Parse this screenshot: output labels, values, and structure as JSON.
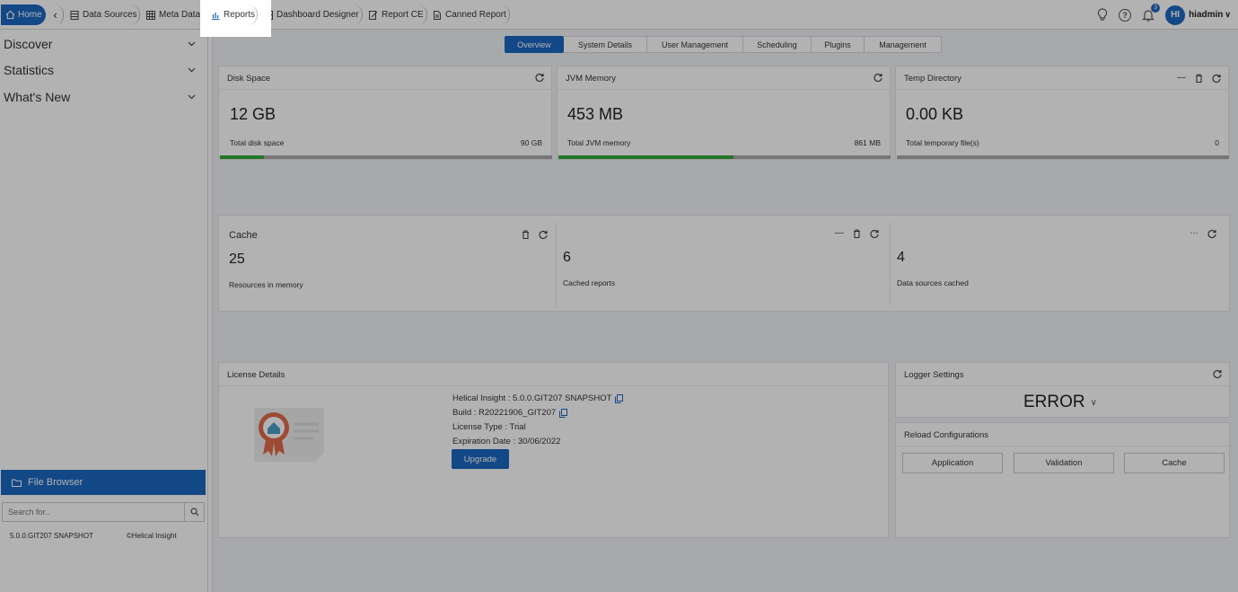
{
  "topbar": {
    "home_label": "Home",
    "tabs": [
      {
        "label": "Data Sources",
        "icon": "table-icon"
      },
      {
        "label": "Meta Data",
        "icon": "grid-icon"
      },
      {
        "label": "Reports",
        "icon": "bar-chart-icon"
      },
      {
        "label": "Dashboard Designer",
        "icon": "image-icon"
      },
      {
        "label": "Report CE",
        "icon": "edit-doc-icon"
      },
      {
        "label": "Canned Report",
        "icon": "document-icon"
      }
    ],
    "notification_count": "3",
    "avatar_initials": "HI",
    "username": "hiadmin"
  },
  "sidebar": {
    "items": [
      {
        "label": "Discover"
      },
      {
        "label": "Statistics"
      },
      {
        "label": "What's New"
      }
    ],
    "file_browser_label": "File Browser",
    "search_placeholder": "Search for..",
    "version": "5.0.0.GIT207 SNAPSHOT",
    "brand": "Helical Insight"
  },
  "subtabs": [
    "Overview",
    "System Details",
    "User Management",
    "Scheduling",
    "Plugins",
    "Management"
  ],
  "disk": {
    "title": "Disk Space",
    "value": "12 GB",
    "label": "Total disk space",
    "total": "90 GB",
    "used_fraction": 0.133
  },
  "jvm": {
    "title": "JVM Memory",
    "value": "453 MB",
    "label": "Total JVM memory",
    "total": "861 MB",
    "used_fraction": 0.526
  },
  "temp": {
    "title": "Temp Directory",
    "value": "0.00 KB",
    "label": "Total temporary file(s)",
    "total": "0",
    "used_fraction": 0
  },
  "cache": {
    "title": "Cache",
    "resources_value": "25",
    "resources_label": "Resources in memory",
    "reports_value": "6",
    "reports_label": "Cached reports",
    "datasources_value": "4",
    "datasources_label": "Data sources cached"
  },
  "license": {
    "title": "License Details",
    "product": "Helical Insight : 5.0.0.GIT207 SNAPSHOT",
    "build": "Build : R20221906_GIT207",
    "type": "License Type : Trial",
    "expiration": "Expiration Date : 30/06/2022",
    "upgrade_label": "Upgrade"
  },
  "logger": {
    "title": "Logger Settings",
    "level": "ERROR"
  },
  "reload": {
    "title": "Reload Configurations",
    "buttons": [
      "Application",
      "Validation",
      "Cache"
    ]
  },
  "colors": {
    "accent": "#1c67c2",
    "progress": "#35a83a"
  }
}
